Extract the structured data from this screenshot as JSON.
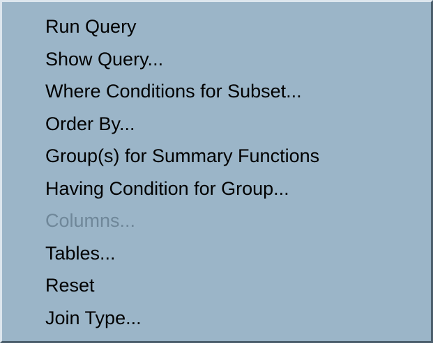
{
  "menu": {
    "items": [
      {
        "label": "Run Query",
        "enabled": true
      },
      {
        "label": "Show Query...",
        "enabled": true
      },
      {
        "label": "Where Conditions for Subset...",
        "enabled": true
      },
      {
        "label": "Order By...",
        "enabled": true
      },
      {
        "label": "Group(s) for Summary Functions",
        "enabled": true
      },
      {
        "label": "Having Condition for Group...",
        "enabled": true
      },
      {
        "label": "Columns...",
        "enabled": false
      },
      {
        "label": "Tables...",
        "enabled": true
      },
      {
        "label": "Reset",
        "enabled": true
      },
      {
        "label": "Join Type...",
        "enabled": true
      }
    ]
  }
}
